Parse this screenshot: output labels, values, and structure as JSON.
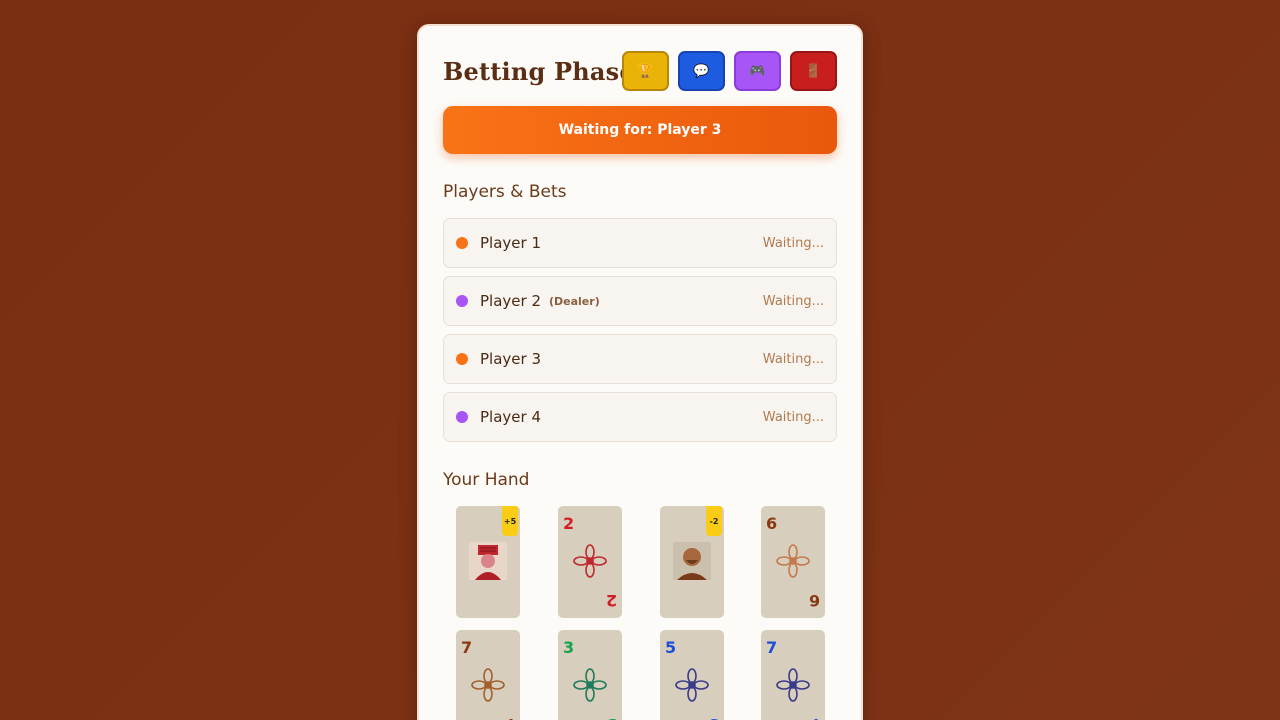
{
  "header": {
    "title": "Betting Phase"
  },
  "toolbar": {
    "buttons": [
      {
        "icon": "trophy-icon",
        "glyph": "🏆",
        "color": "#eab308"
      },
      {
        "icon": "chat-icon",
        "glyph": "💬",
        "color": "#1d5be0"
      },
      {
        "icon": "gamepad-icon",
        "glyph": "🎮",
        "color": "#a855f7"
      },
      {
        "icon": "door-exit-icon",
        "glyph": "🚪",
        "color": "#c81e1e"
      }
    ]
  },
  "status_banner": "Waiting for: Player 3",
  "players_section": {
    "title": "Players & Bets",
    "players": [
      {
        "name": "Player 1",
        "dealer_label": "",
        "status": "Waiting...",
        "color": "#f97316"
      },
      {
        "name": "Player 2",
        "dealer_label": "(Dealer)",
        "status": "Waiting...",
        "color": "#a855f7"
      },
      {
        "name": "Player 3",
        "dealer_label": "",
        "status": "Waiting...",
        "color": "#f97316"
      },
      {
        "name": "Player 4",
        "dealer_label": "",
        "status": "Waiting...",
        "color": "#a855f7"
      }
    ]
  },
  "hand_section": {
    "title": "Your Hand",
    "cards": [
      {
        "type": "special",
        "figure": "hat-figure",
        "badge": "+5",
        "color": "#c0262e"
      },
      {
        "type": "number",
        "value": "2",
        "color": "#d11f2a"
      },
      {
        "type": "special",
        "figure": "bald-figure",
        "badge": "-2",
        "color": "#7a3a1a"
      },
      {
        "type": "number",
        "value": "6",
        "color": "#8a3a12"
      },
      {
        "type": "number",
        "value": "7",
        "color": "#8a3a12"
      },
      {
        "type": "number",
        "value": "3",
        "color": "#16a34a"
      },
      {
        "type": "number",
        "value": "5",
        "color": "#1d4ed8"
      },
      {
        "type": "number",
        "value": "7",
        "color": "#1d4ed8"
      }
    ]
  }
}
